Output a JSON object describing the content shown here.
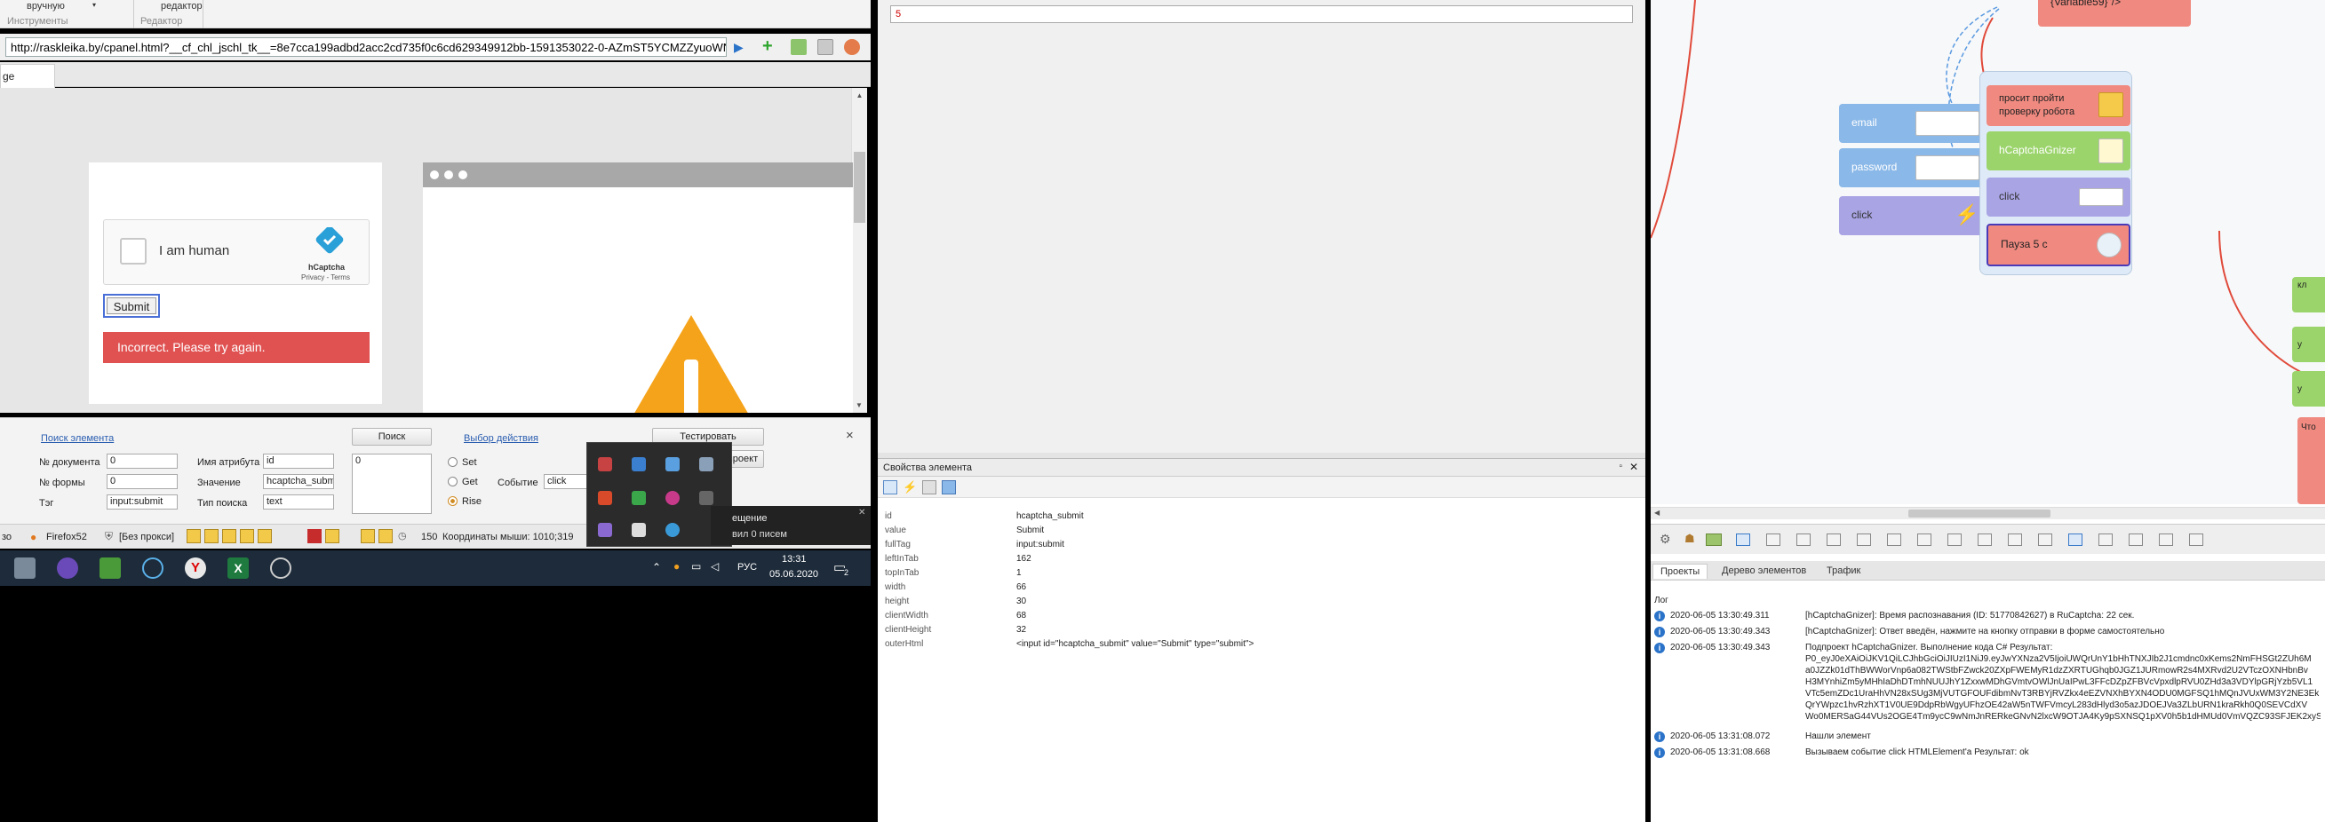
{
  "ribbon": {
    "item1": "вручную",
    "item1_sub": "Инструменты",
    "item2": "редактор",
    "item2_sub": "Редактор"
  },
  "browser": {
    "url": "http://raskleika.by/cpanel.html?__cf_chl_jschl_tk__=8e7cca199adbd2acc2cd735f0c6cd629349912bb-1591353022-0-AZmST5YCMZZyuoWN0C",
    "tab_label": "ge"
  },
  "page": {
    "captcha_label": "I am human",
    "captcha_brand": "hCaptcha",
    "captcha_links": "Privacy - Terms",
    "submit_label": "Submit",
    "error_text": "Incorrect. Please try again."
  },
  "search_panel": {
    "search_element_link": "Поиск элемента",
    "doc_no_label": "№ документа",
    "doc_no_value": "0",
    "form_no_label": "№ формы",
    "form_no_value": "0",
    "tag_label": "Тэг",
    "tag_value": "input:submit",
    "attr_name_label": "Имя атрибута",
    "attr_name_value": "id",
    "value_label": "Значение",
    "value_value": "hcaptcha_subm",
    "search_type_label": "Тип поиска",
    "search_type_value": "text",
    "search_button": "Поиск",
    "results_value": "0",
    "choose_action_link": "Выбор действия",
    "test_button": "Тестировать",
    "project_button": "проект",
    "radio_set": "Set",
    "radio_get": "Get",
    "radio_rise": "Rise",
    "event_label": "Событие",
    "event_value": "click",
    "close": "×"
  },
  "statusbar": {
    "left_text": "зо",
    "browser_name": "Firefox52",
    "proxy": "[Без прокси]",
    "count": "150",
    "coords": "Координаты мыши: 1010;319"
  },
  "notification": {
    "title": "ещение",
    "text": "вил 0 писем"
  },
  "taskbar": {
    "lang": "РУС",
    "time": "13:31",
    "date": "05.06.2020",
    "badge": "2"
  },
  "mid": {
    "input_value": "5"
  },
  "props": {
    "title": "Свойства элемента",
    "rows": [
      {
        "key": "id",
        "val": "hcaptcha_submit"
      },
      {
        "key": "value",
        "val": "Submit"
      },
      {
        "key": "fullTag",
        "val": "input:submit"
      },
      {
        "key": "leftInTab",
        "val": "162"
      },
      {
        "key": "topInTab",
        "val": "1"
      },
      {
        "key": "width",
        "val": "66"
      },
      {
        "key": "height",
        "val": "30"
      },
      {
        "key": "clientWidth",
        "val": "68"
      },
      {
        "key": "clientHeight",
        "val": "32"
      },
      {
        "key": "outerHtml",
        "val": "<input id=\"hcaptcha_submit\" value=\"Submit\" type=\"submit\">"
      }
    ]
  },
  "flow": {
    "top_node": "{Variable59}\"/>",
    "email": "email",
    "password": "password",
    "click_left": "click",
    "prompt_node": "просит пройти проверку робота",
    "hcaptcha_node": "hCaptchaGnizer",
    "click_right": "click",
    "pause_node": "Пауза 5 с",
    "edge_1": "кл",
    "edge_2": "у",
    "edge_3": "у",
    "edge_4": "Что"
  },
  "right_tabs": {
    "projects": "Проекты",
    "tree": "Дерево элементов",
    "traffic": "Трафик"
  },
  "log": {
    "title": "Лог",
    "rows": [
      {
        "time": "2020-06-05   13:30:49.311",
        "text": "[hCaptchaGnizer]: Время распознавания (ID: 51770842627) в RuCaptcha: 22 сек."
      },
      {
        "time": "2020-06-05   13:30:49.343",
        "text": "[hCaptchaGnizer]: Ответ введён, нажмите на кнопку отправки в форме самостоятельно"
      },
      {
        "time": "2020-06-05   13:30:49.343",
        "text": "Подпроект hCaptchaGnizer. Выполнение кода C# Результат:"
      },
      {
        "time": "",
        "text": "P0_eyJ0eXAiOiJKV1QiLCJhbGciOiJIUzI1NiJ9.eyJwYXNza2V5IjoiUWQrUnY1bHhTNXJIb2J1cmdnc0xKems2NmFHSGt2ZUh6M"
      },
      {
        "time": "",
        "text": "a0JZZk01dThBWWorVnp6a082TWStbFZwck20ZXpFWEMyR1dzZXRTUGhqb0JGZ1JURmowR2s4MXRvd2U2VTczOXNHbnBv"
      },
      {
        "time": "",
        "text": "H3MYnhiZm5yMHhIaDhDTmhNUUJhY1ZxxwMDhGVmtvOWlJnUaIPwL3FFcDZpZFBVcVpxdlpRVU0ZHd3a3VDYlpGRjYzb5VL1"
      },
      {
        "time": "",
        "text": "VTc5emZDc1UraHhVN28xSUg3MjVUTGFOUFdibmNvT3RBYjRVZkx4eEZVNXhBYXN4ODU0MGFSQ1hMQnJVUxWM3Y2NE3Ek"
      },
      {
        "time": "",
        "text": "QrYWpzc1hvRzhXT1V0UE9DdpRbWgyUFhzOE42aW5nTWFVmcyL283dHlyd3o5azJDOEJVa3ZLbURN1kraRkh0Q0SEVCdXV"
      },
      {
        "time": "",
        "text": "Wo0MERSaG44VUs2OGE4Tm9ycC9wNmJnRERkeGNvN2lxcW9OTJA4Ky9pSXNSQ1pXV0h5b1dHMUd0VmVQZC93SFJEK2xyS"
      },
      {
        "time": "2020-06-05   13:31:08.072",
        "text": "Нашли элемент"
      },
      {
        "time": "2020-06-05   13:31:08.668",
        "text": "Вызываем событие click HTMLElement'a  Результат: ok"
      }
    ]
  },
  "colors": {
    "error_red": "#e05252",
    "captcha_brand": "#2aa0d8",
    "warning_orange": "#f5a31a",
    "node_red": "#f08a80",
    "node_green": "#9bd46b",
    "node_blue": "#8ab8e8",
    "node_purple": "#a9a4e4"
  }
}
